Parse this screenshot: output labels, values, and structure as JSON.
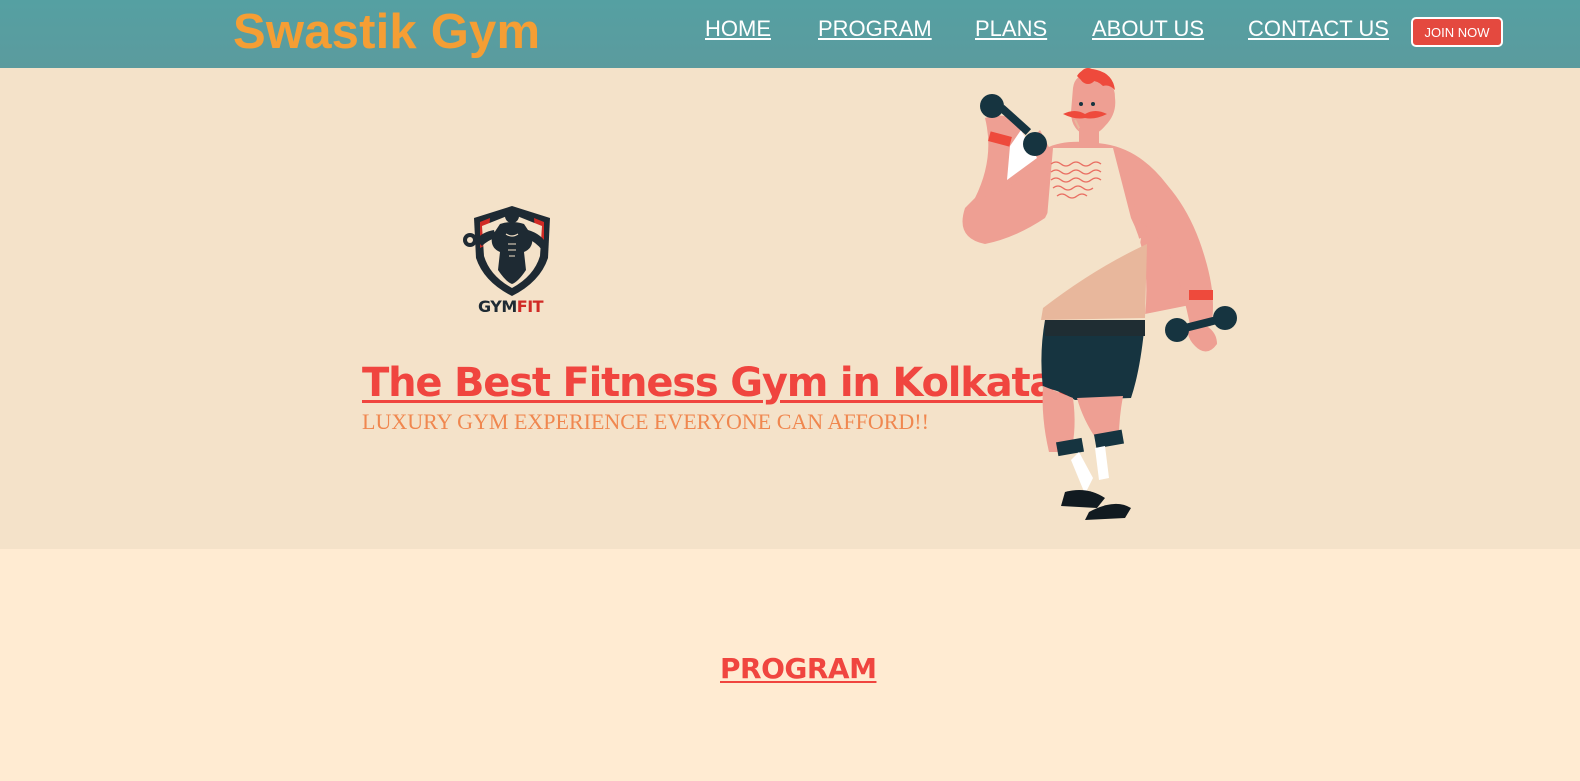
{
  "header": {
    "brand": "Swastik Gym",
    "nav": {
      "home": "HOME",
      "program": "PROGRAM",
      "plans": "PLANS",
      "about": "ABOUT US",
      "contact": "CONTACT US"
    },
    "join_button": "JOIN NOW"
  },
  "hero": {
    "logo_text_gym": "GYM",
    "logo_text_fit": "FIT",
    "title": "The Best Fitness Gym in Kolkata.",
    "subtitle": "LUXURY GYM EXPERIENCE EVERYONE CAN AFFORD!!"
  },
  "program_section": {
    "title": "PROGRAM"
  },
  "colors": {
    "navbar": "#5a9e9f",
    "brand": "#f59e34",
    "hero_bg": "#f4e2c9",
    "page_bg": "#ffebd2",
    "accent_red": "#f0453f",
    "subtitle_orange": "#f0874f"
  }
}
